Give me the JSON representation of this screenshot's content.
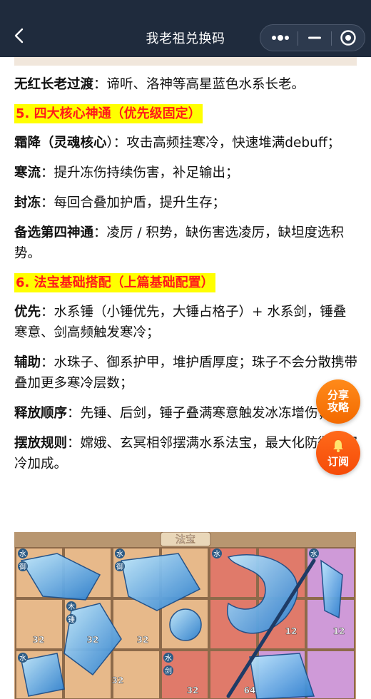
{
  "header": {
    "title": "我老祖兑换码"
  },
  "paragraphs_a": [
    {
      "bold": "无红长老过渡",
      "text": "：谛听、洛神等高星蓝色水系长老。"
    }
  ],
  "section5": "5. 四大核心神通（优先级固定）",
  "paragraphs_b": [
    {
      "bold": "霜降（灵魂核心",
      "text": "）：攻击高频挂寒冷，快速堆满debuff；"
    },
    {
      "bold": "寒流",
      "text": "：提升冻伤持续伤害，补足输出；"
    },
    {
      "bold": "封冻",
      "text": "：每回合叠加护盾，提升生存；"
    },
    {
      "bold": "备选第四神通",
      "text": "：凌厉 / 积势，缺伤害选凌厉，缺坦度选积势。"
    }
  ],
  "section6": "6. 法宝基础搭配（上篇基础配置）",
  "paragraphs_c": [
    {
      "bold": "优先",
      "text": "：水系锤（小锤优先，大锤占格子）+ 水系剑，锤叠寒意、剑高频触发寒冷；"
    },
    {
      "bold": "辅助",
      "text": "：水珠子、御系护甲，堆护盾厚度；珠子不会分散携带叠加更多寒冷层数；"
    },
    {
      "bold": "释放顺序",
      "text": "：先锤、后剑，锤子叠满寒意触发冰冻增伤；"
    },
    {
      "bold": "摆放规则",
      "text": "：嫦娥、玄冥相邻摆满水系法宝，最大化防御与寒冷加成。"
    }
  ],
  "game_image": {
    "banner": "法宝",
    "tags": [
      "水",
      "御",
      "木",
      "锤",
      "剑"
    ],
    "numbers": [
      "32",
      "32",
      "12",
      "32",
      "12",
      "64",
      "32",
      "32"
    ]
  },
  "floating": {
    "share_line1": "分享",
    "share_line2": "攻略",
    "subscribe": "订阅"
  },
  "colors": {
    "header_bg": "#1f2b3d",
    "highlight": "#ffff00",
    "section_text": "#ff1a1a",
    "float_orange": "#f36a00"
  }
}
